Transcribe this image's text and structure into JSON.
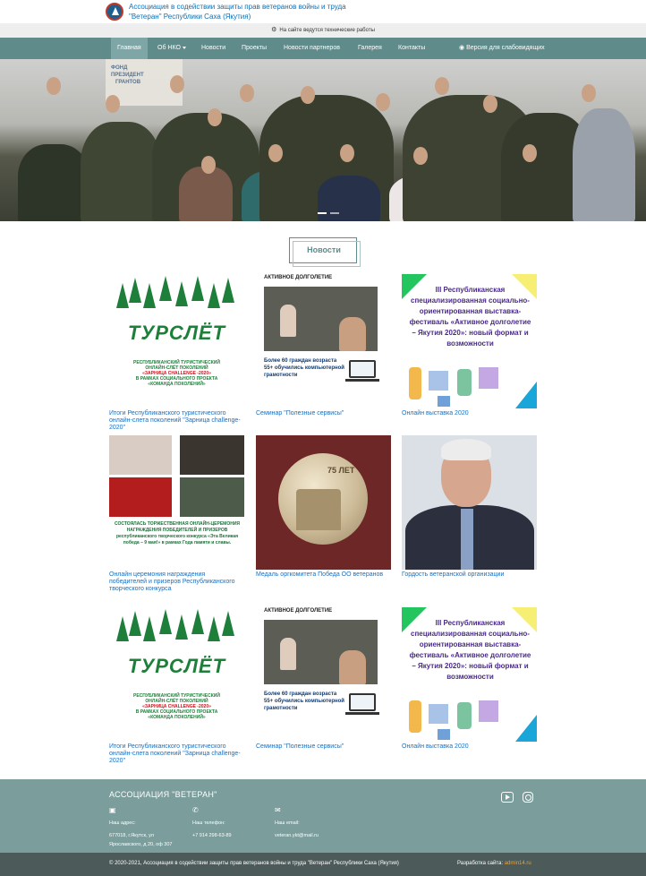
{
  "header": {
    "org_title": "Ассоциация в содействии защиты прав ветеранов войны и труда \"Ветеран\" Республики Саха (Якутия)"
  },
  "notice": {
    "text": "На сайте ведутся технические работы"
  },
  "nav": {
    "items": [
      "Главная",
      "Об НКО",
      "Новости",
      "Проекты",
      "Новости партнеров",
      "Галерея",
      "Контакты"
    ],
    "accessibility": "Версия для слабовидящих"
  },
  "hero": {
    "banner": "ФОНД\nПРЕЗИДЕНТ\n   ГРАНТОВ"
  },
  "news": {
    "heading": "Новости",
    "cards": [
      {
        "caption": "Итоги Республиканского туристического онлайн-слета поколений \"Зарница challenge-2020\""
      },
      {
        "caption": "Семинар \"Полезные сервисы\""
      },
      {
        "caption": "Онлайн выставка 2020"
      },
      {
        "caption": "Онлайн церемония награждения победителей и призеров Республиканского творческого конкурса"
      },
      {
        "caption": "Медаль оргкомитета Победа ОО ветеранов"
      },
      {
        "caption": "Гордость ветеранской организации"
      },
      {
        "caption": "Итоги Республиканского туристического онлайн-слета поколений \"Зарница challenge-2020\""
      },
      {
        "caption": "Семинар \"Полезные сервисы\""
      },
      {
        "caption": "Онлайн выставка 2020"
      }
    ]
  },
  "posters": {
    "tur_word": "ТУРСЛЁТ",
    "tur_line1": "РЕСПУБЛИКАНСКИЙ ТУРИСТИЧЕСКИЙ",
    "tur_line2": "ОНЛАЙН-СЛЁТ ПОКОЛЕНИЙ",
    "tur_line3": "«ЗАРНИЦА CHALLENGE -2020»",
    "tur_line4": "В РАМКАХ СОЦИАЛЬНОГО ПРОЕКТА",
    "tur_line5": "«КОМАНДА ПОКОЛЕНИЙ»",
    "al_title": "АКТИВНОЕ ДОЛГОЛЕТИЕ",
    "al_text": "Более 60 граждан возраста 55+ обучились компьютерной грамотности",
    "ex_text": "III Республиканская специализированная социально-ориентированная выставка-фестиваль «Активное долголетие – Якутия 2020»: новый формат и возможности",
    "cer_text": "СОСТОЯЛАСЬ ТОРЖЕСТВЕННАЯ ОНЛАЙН-ЦЕРЕМОНИЯ НАГРАЖДЕНИЯ ПОБЕДИТЕЛЕЙ И ПРИЗЕРОВ республиканского творческого конкурса «Эта Великая победа – 9 мая!» в рамках Года памяти и славы.",
    "medal_text": "75 ЛЕТ"
  },
  "footer": {
    "title": "АССОЦИАЦИЯ \"ВЕТЕРАН\"",
    "address_label": "Наш адрес:",
    "address_value": "677018, г.Якутск, ул Ярославского, д 20, оф 307",
    "phone_label": "Наш телефон:",
    "phone_value": "+7 914 298-63-89",
    "email_label": "Наш email:",
    "email_value": "veteran.ykt@mail.ru",
    "copyright": "© 2020-2021, Ассоциация в содействии защиты прав ветеранов войны и труда \"Ветеран\" Республики Саха (Якутия)",
    "dev_label": "Разработка сайта:",
    "dev_link": "admin14.ru"
  },
  "colors": {
    "nav": "#5f8b8b",
    "footer": "#7b9d9b",
    "link": "#1a6fbd"
  },
  "icons": [
    "gear-icon",
    "caret-down-icon",
    "eye-icon",
    "map-marker-icon",
    "phone-icon",
    "mail-icon",
    "youtube-icon",
    "instagram-icon"
  ]
}
